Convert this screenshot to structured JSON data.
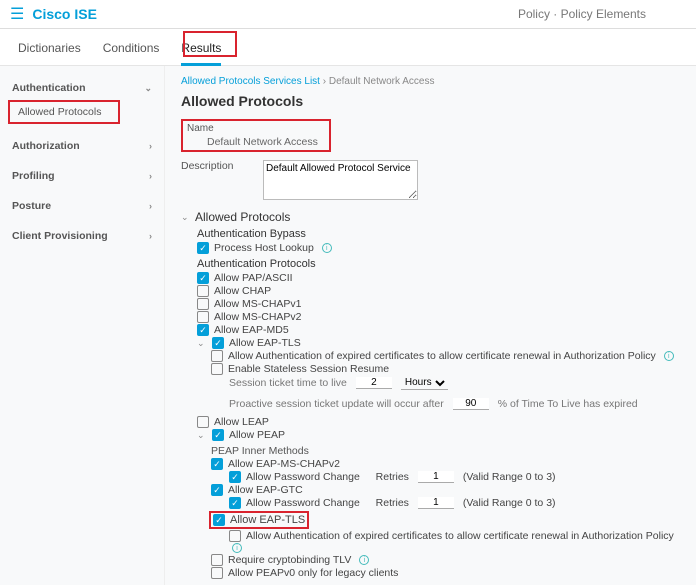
{
  "brand": "Cisco ISE",
  "crumbs": "Policy · Policy Elements",
  "tabs": {
    "dict": "Dictionaries",
    "cond": "Conditions",
    "res": "Results"
  },
  "sidebar": {
    "auth": "Authentication",
    "allowed": "Allowed Protocols",
    "authz": "Authorization",
    "profiling": "Profiling",
    "posture": "Posture",
    "client": "Client Provisioning"
  },
  "bc": {
    "root": "Allowed Protocols Services List",
    "cur": "Default Network Access"
  },
  "title": "Allowed Protocols",
  "name_label": "Name",
  "name_value": "Default Network Access",
  "desc_label": "Description",
  "desc_value": "Default Allowed Protocol Service",
  "section": "Allowed Protocols",
  "bypass_hdr": "Authentication Bypass",
  "process_host": "Process Host Lookup",
  "proto_hdr": "Authentication Protocols",
  "pap": "Allow PAP/ASCII",
  "chap": "Allow CHAP",
  "mschap1": "Allow MS-CHAPv1",
  "mschap2": "Allow MS-CHAPv2",
  "eapmd5": "Allow EAP-MD5",
  "eaptls": "Allow EAP-TLS",
  "eaptls_expired": "Allow Authentication of expired certificates to allow certificate renewal in Authorization Policy",
  "stateless": "Enable Stateless Session Resume",
  "sess_ttl_label": "Session ticket time to live",
  "sess_ttl_val": "2",
  "sess_ttl_unit": "Hours",
  "proactive_pre": "Proactive session ticket update will occur after",
  "proactive_val": "90",
  "proactive_post": "% of Time To Live has expired",
  "leap": "Allow LEAP",
  "peap": "Allow PEAP",
  "peap_inner": "PEAP Inner Methods",
  "eapmschap2": "Allow EAP-MS-CHAPv2",
  "pwchange": "Allow Password Change",
  "retries": "Retries",
  "retries_val": "1",
  "retries_range": "(Valid Range 0 to 3)",
  "eapgtc": "Allow EAP-GTC",
  "eaptls2": "Allow EAP-TLS",
  "eaptls2_expired": "Allow Authentication of expired certificates to allow certificate renewal in Authorization Policy",
  "cryptobind": "Require cryptobinding TLV",
  "peapv0": "Allow PEAPv0 only for legacy clients"
}
